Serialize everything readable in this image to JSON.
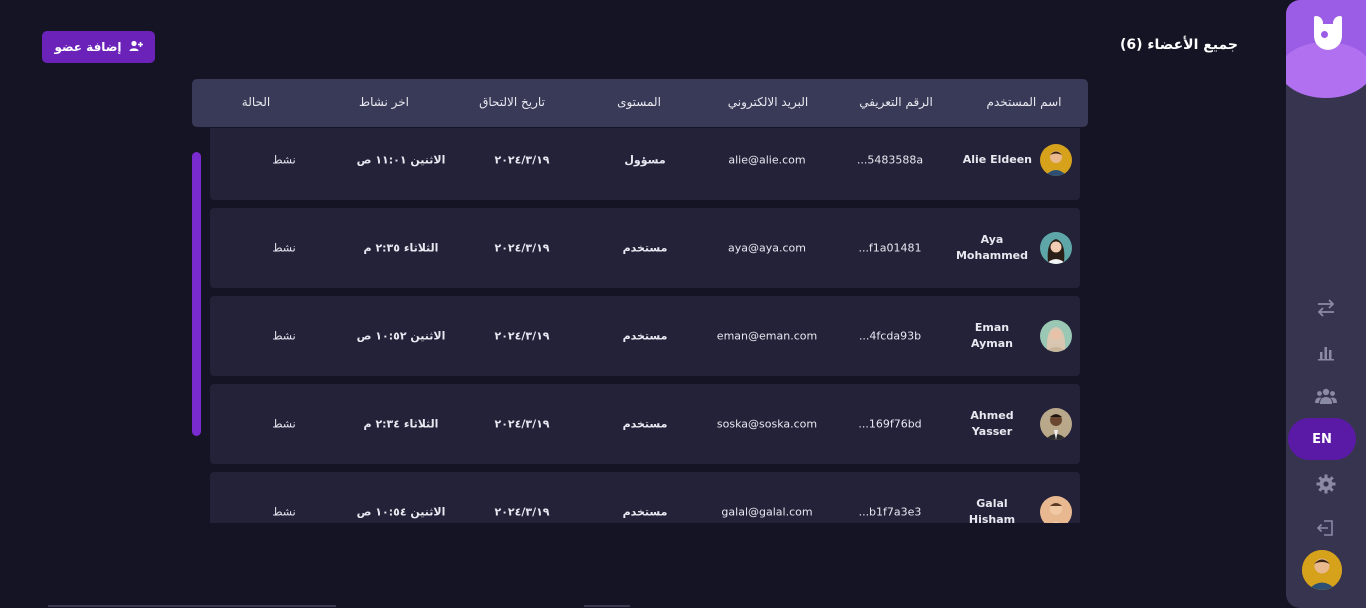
{
  "header": {
    "title": "جميع الأعضاء (6)",
    "add_button_label": "إضافة عضو"
  },
  "table": {
    "columns": [
      "اسم المستخدم",
      "الرقم التعريفي",
      "البريد الالكتروني",
      "المستوى",
      "تاريخ الالتحاق",
      "اخر نشاط",
      "الحالة"
    ],
    "rows": [
      {
        "name": "Alie Eldeen",
        "id": "...5483588a",
        "email": "alie@alie.com",
        "level": "مسؤول",
        "joined": "٢٠٢٤/٣/١٩",
        "last_active": "الاثنين ١١:٠١ ص",
        "status": "نشط",
        "avatar_color": "#d6a21c"
      },
      {
        "name": "Aya Mohammed",
        "id": "...f1a01481",
        "email": "aya@aya.com",
        "level": "مستخدم",
        "joined": "٢٠٢٤/٣/١٩",
        "last_active": "الثلاثاء ٢:٣٥ م",
        "status": "نشط",
        "avatar_color": "#5fa6a8"
      },
      {
        "name": "Eman Ayman",
        "id": "...4fcda93b",
        "email": "eman@eman.com",
        "level": "مستخدم",
        "joined": "٢٠٢٤/٣/١٩",
        "last_active": "الاثنين ١٠:٥٢ ص",
        "status": "نشط",
        "avatar_color": "#9bc7b5"
      },
      {
        "name": "Ahmed Yasser",
        "id": "...169f76bd",
        "email": "soska@soska.com",
        "level": "مستخدم",
        "joined": "٢٠٢٤/٣/١٩",
        "last_active": "الثلاثاء ٢:٣٤ م",
        "status": "نشط",
        "avatar_color": "#b9a98a"
      },
      {
        "name": "Galal Hisham",
        "id": "...b1f7a3e3",
        "email": "galal@galal.com",
        "level": "مستخدم",
        "joined": "٢٠٢٤/٣/١٩",
        "last_active": "الاثنين ١٠:٥٤ ص",
        "status": "نشط",
        "avatar_color": "#e8b890"
      }
    ]
  },
  "sidebar": {
    "icons": [
      "swap-icon",
      "chart-icon",
      "users-icon",
      "gear-icon",
      "logout-icon"
    ],
    "lang_label": "EN",
    "accent": "#9b5de5"
  }
}
